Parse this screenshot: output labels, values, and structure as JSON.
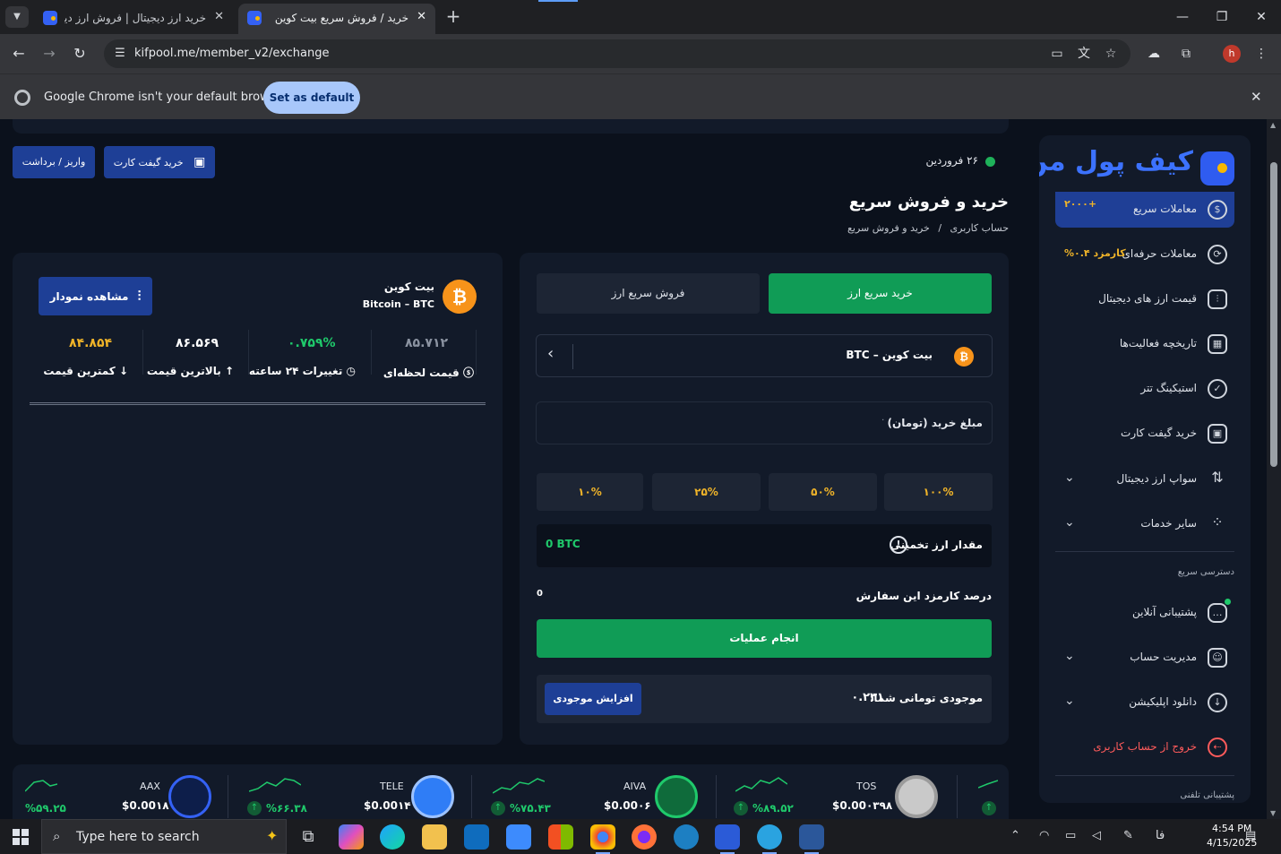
{
  "browser": {
    "tabs": [
      {
        "title": "خرید ارز دیجیتال | فروش ارز دیجیتال",
        "active": false
      },
      {
        "title": "خرید / فروش سریع بیت کوین",
        "active": true
      }
    ],
    "url": "kifpool.me/member_v2/exchange",
    "profile_initial": "h",
    "infobar_text": "Google Chrome isn't your default browser",
    "infobar_button": "Set as default"
  },
  "sidebar": {
    "brand": "کیف پول من",
    "items": [
      {
        "label": "معاملات سریع",
        "extra": "+۲۰۰۰",
        "icon": "dollar-icon"
      },
      {
        "label": "معاملات حرفه‌ای",
        "extra": "کارمزد ۰.۴%",
        "icon": "trade-icon"
      },
      {
        "label": "قیمت ارز های دیجیتال",
        "icon": "price-icon"
      },
      {
        "label": "تاریخچه فعالیت‌ها",
        "icon": "calendar-icon"
      },
      {
        "label": "استیکینگ تتر",
        "icon": "staking-icon"
      },
      {
        "label": "خرید گیفت کارت",
        "icon": "gift-icon"
      },
      {
        "label": "سواپ ارز دیجیتال",
        "icon": "swap-icon"
      },
      {
        "label": "سایر خدمات",
        "icon": "grid-icon"
      }
    ],
    "quick_access_title": "دسترسی سریع",
    "quick_items": [
      {
        "label": "پشتیبانی آنلاین",
        "icon": "chat-icon"
      },
      {
        "label": "مدیریت حساب",
        "icon": "account-icon"
      },
      {
        "label": "دانلود اپلیکیشن",
        "icon": "download-icon"
      },
      {
        "label": "خروج از حساب کاربری",
        "icon": "logout-icon"
      }
    ],
    "phone_support_title": "پشتیبانی تلفنی"
  },
  "header": {
    "date": "۲۶ فروردین",
    "title": "خرید و فروش سریع",
    "breadcrumb": [
      "حساب کاربری",
      "/",
      "خرید و فروش سریع"
    ],
    "btn_gift": "خرید گیفت کارت",
    "btn_deposit": "واریز / برداشت"
  },
  "trade": {
    "tab_buy": "خرید سریع ارز",
    "tab_sell": "فروش سریع ارز",
    "coin_select": "بیت کوین – BTC",
    "amount_label": "مبلغ خرید (تومان)",
    "amount_value": "۰",
    "percents": [
      "۱۰۰%",
      "۵۰%",
      "۲۵%",
      "۱۰%"
    ],
    "estimate_label": "مقدار ارز تخمینی",
    "estimate_value": "0 BTC",
    "fee_label": "درصد کارمزد این سفارش",
    "fee_value": "0",
    "submit": "انجام عملیات",
    "balance_label": "موجودی تومانی شما:",
    "balance_value": "۰.۲۳۱",
    "balance_button": "افزایش موجودی"
  },
  "coin": {
    "name": "بیت کوین",
    "pair": "Bitcoin – BTC",
    "chart_button": "مشاهده نمودار",
    "stats": [
      {
        "label": "قیمت لحظه‌ای",
        "value": "۸۵.۷۱۲",
        "color": "#8b93a1"
      },
      {
        "label": "تغییرات ۲۴ ساعته",
        "value": "۰.۷۵۹%",
        "color": "#1fc96b"
      },
      {
        "label": "بالاترین قیمت",
        "value": "۸۶.۵۶۹",
        "color": "#ffffff"
      },
      {
        "label": "کمترین قیمت",
        "value": "۸۴.۸۵۴",
        "color": "#f0b429"
      }
    ]
  },
  "ticker": [
    {
      "symbol": "TOS",
      "price": "$0.00۰۳۹۸",
      "change": "%۸۹.۵۲"
    },
    {
      "symbol": "AIVA",
      "price": "$0.00۰۶",
      "change": "%۷۵.۴۳"
    },
    {
      "symbol": "TELE",
      "price": "$0.00۱۴",
      "change": "%۶۶.۳۸"
    },
    {
      "symbol": "AAX",
      "price": "$0.00۱۸",
      "change": "%۵۹.۲۵"
    }
  ],
  "taskbar": {
    "search_placeholder": "Type here to search",
    "lang": "فا",
    "time": "4:54 PM",
    "date": "4/15/2025"
  },
  "colors": {
    "accent_green": "#109c56",
    "accent_blue": "#1e3f96",
    "gold": "#f0b429"
  }
}
